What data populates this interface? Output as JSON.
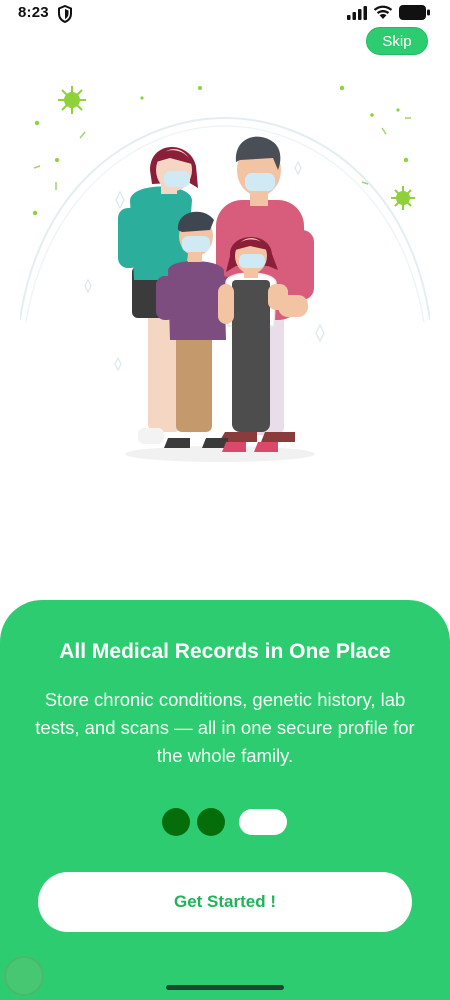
{
  "status_bar": {
    "time": "8:23",
    "icons": [
      "shield-icon",
      "signal-icon",
      "wifi-icon",
      "battery-icon"
    ]
  },
  "header": {
    "skip_label": "Skip"
  },
  "illustration": {
    "name": "family-with-masks-illustration"
  },
  "onboarding": {
    "title": "All Medical Records in One Place",
    "description": "Store chronic conditions, genetic history, lab tests, and scans — all in one secure profile for the whole family.",
    "page_count": 3,
    "active_page": 3,
    "cta_label": "Get Started !"
  },
  "colors": {
    "accent": "#2ecc71",
    "dot_inactive": "#066d0b",
    "dot_active": "#ffffff",
    "cta_text": "#21b35a"
  }
}
